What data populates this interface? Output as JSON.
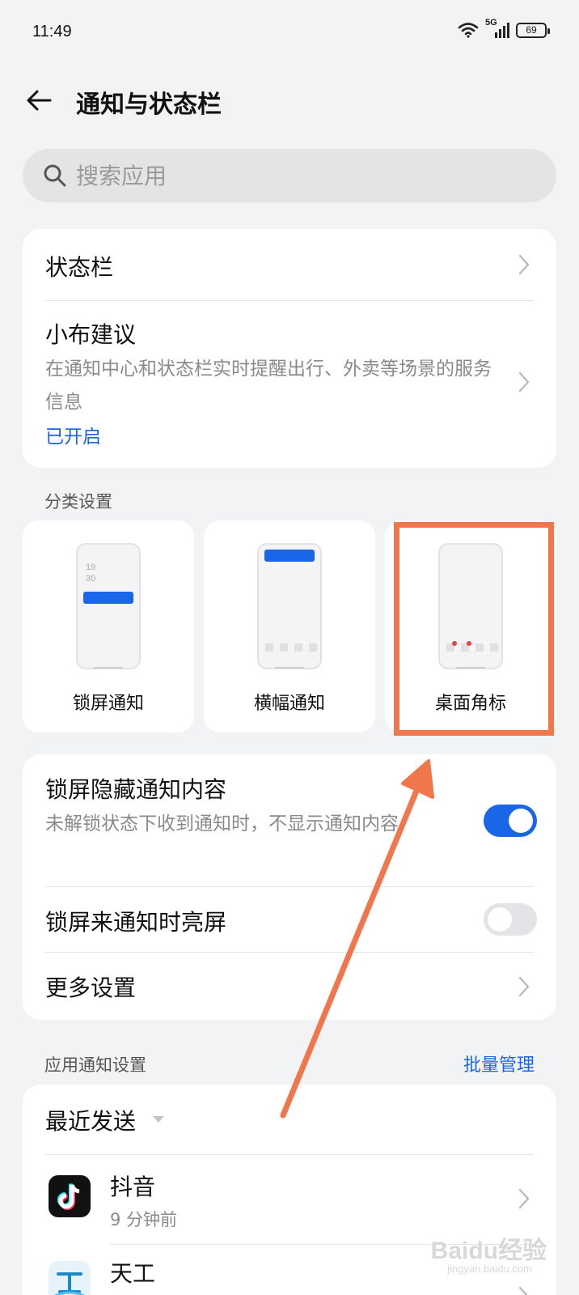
{
  "status": {
    "time": "11:49",
    "network": "5G",
    "battery": "69"
  },
  "header": {
    "title": "通知与状态栏"
  },
  "search": {
    "placeholder": "搜索应用"
  },
  "top_card": {
    "status_bar_label": "状态栏",
    "suggestion_title": "小布建议",
    "suggestion_desc": "在通知中心和状态栏实时提醒出行、外卖等场景的服务信息",
    "suggestion_status": "已开启"
  },
  "category": {
    "section_label": "分类设置",
    "items": [
      {
        "label": "锁屏通知",
        "clock_hour": "19",
        "clock_minute": "30"
      },
      {
        "label": "横幅通知"
      },
      {
        "label": "桌面角标"
      }
    ]
  },
  "lock_card": {
    "hide_title": "锁屏隐藏通知内容",
    "hide_desc": "未解锁状态下收到通知时，不显示通知内容",
    "hide_enabled": true,
    "wake_title": "锁屏来通知时亮屏",
    "wake_enabled": false,
    "more_label": "更多设置"
  },
  "app_section": {
    "label": "应用通知设置",
    "batch_label": "批量管理",
    "sort_label": "最近发送",
    "apps": [
      {
        "name": "抖音",
        "time": "9 分钟前"
      },
      {
        "name": "天工",
        "time": ""
      }
    ]
  },
  "watermark": {
    "brand": "Baidu经验",
    "url": "jingyan.baidu.com"
  },
  "colors": {
    "accent": "#1a66e8",
    "highlight": "#f0764b",
    "toggle_off": "#e4e4e6"
  }
}
